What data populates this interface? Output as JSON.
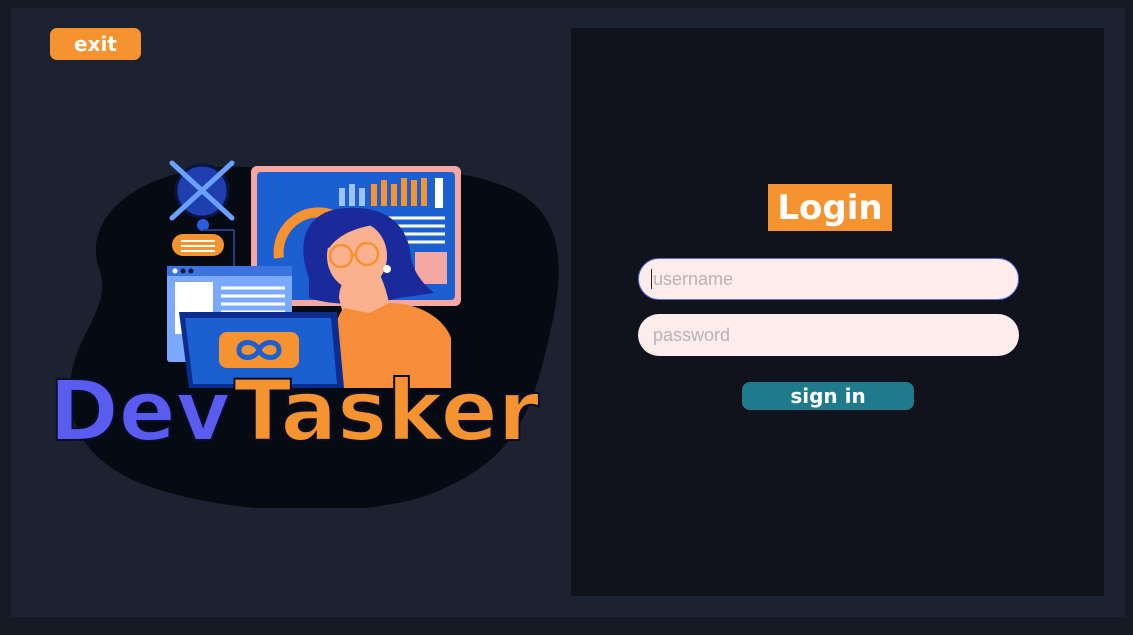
{
  "header": {
    "exit_label": "exit"
  },
  "logo": {
    "brand_part1": "Dev",
    "brand_part2": "Tasker"
  },
  "login": {
    "title": "Login",
    "username_placeholder": "username",
    "password_placeholder": "password",
    "signin_label": "sign in"
  },
  "colors": {
    "accent_orange": "#f59331",
    "button_teal": "#1f7a8c",
    "brand_blue": "#5a5cf0",
    "panel_dark": "#10131b",
    "window_bg": "#1d2230"
  }
}
